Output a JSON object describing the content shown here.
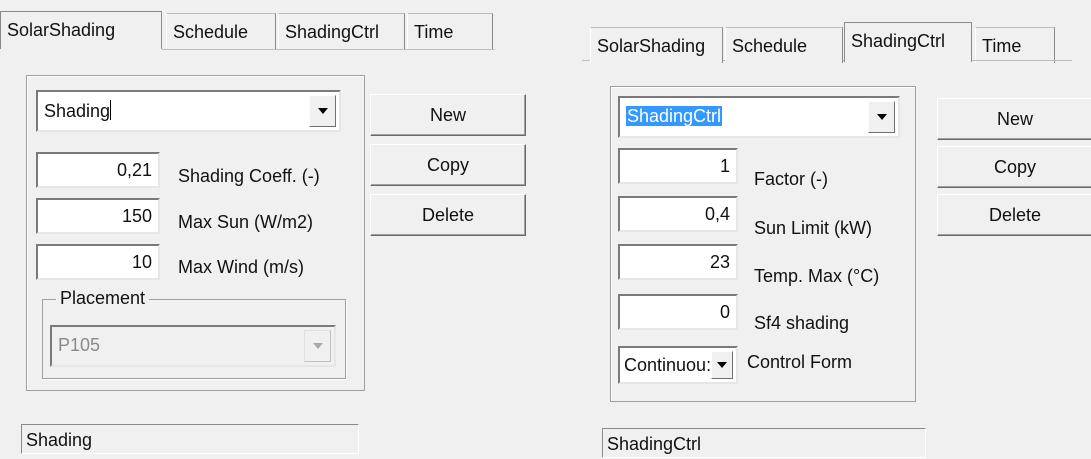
{
  "left": {
    "tabs": [
      "SolarShading",
      "Schedule",
      "ShadingCtrl",
      "Time"
    ],
    "combo_value": "Shading",
    "fields": [
      {
        "value": "0,21",
        "label": "Shading Coeff. (-)"
      },
      {
        "value": "150",
        "label": "Max Sun (W/m2)"
      },
      {
        "value": "10",
        "label": "Max Wind (m/s)"
      }
    ],
    "placement": {
      "legend": "Placement",
      "value": "P105"
    },
    "buttons": {
      "new": "New",
      "copy": "Copy",
      "delete": "Delete"
    },
    "status": "Shading"
  },
  "right": {
    "tabs": [
      "SolarShading",
      "Schedule",
      "ShadingCtrl",
      "Time"
    ],
    "combo_value": "ShadingCtrl",
    "fields": [
      {
        "value": "1",
        "label": "Factor (-)"
      },
      {
        "value": "0,4",
        "label": "Sun Limit (kW)"
      },
      {
        "value": "23",
        "label": "Temp. Max (°C)"
      },
      {
        "value": "0",
        "label": "Sf4 shading"
      }
    ],
    "control_form": {
      "value": "Continuou:",
      "label": "Control Form"
    },
    "buttons": {
      "new": "New",
      "copy": "Copy",
      "delete": "Delete"
    },
    "status": "ShadingCtrl"
  }
}
